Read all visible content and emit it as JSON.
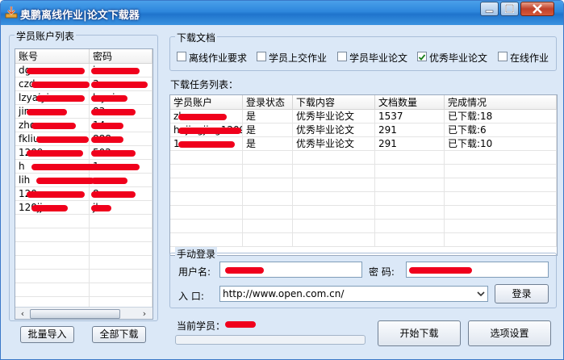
{
  "window": {
    "title": "奥鹏离线作业|论文下载器"
  },
  "accounts": {
    "group_title": "学员账户列表",
    "columns": [
      "账号",
      "密码"
    ],
    "rows": [
      {
        "account": "dg",
        "password": "ia..."
      },
      {
        "account": "czd",
        "password": "3"
      },
      {
        "account": "lzyaiyi",
        "password": "lzyai"
      },
      {
        "account": "jinsu",
        "password": "83"
      },
      {
        "account": "zhou",
        "password": "14"
      },
      {
        "account": "fkliu",
        "password": "888"
      },
      {
        "account": "1209",
        "password": "502"
      },
      {
        "account": "h",
        "password": "1..."
      },
      {
        "account": "lih",
        "password": "..."
      },
      {
        "account": "120",
        "password": "8"
      },
      {
        "account": "120jj",
        "password": "jh"
      }
    ],
    "scroll_left": "‹",
    "scroll_right": "›",
    "btn_import": "批量导入",
    "btn_download_all": "全部下载"
  },
  "download_docs": {
    "group_title": "下载文档",
    "options": [
      {
        "label": "离线作业要求",
        "checked": false
      },
      {
        "label": "学员上交作业",
        "checked": false
      },
      {
        "label": "学员毕业论文",
        "checked": false
      },
      {
        "label": "优秀毕业论文",
        "checked": true
      },
      {
        "label": "在线作业",
        "checked": false
      }
    ]
  },
  "tasks": {
    "title": "下载任务列表：",
    "columns": [
      "学员账户",
      "登录状态",
      "下载内容",
      "文档数量",
      "完成情况"
    ],
    "rows": [
      {
        "account": "zh",
        "status": "是",
        "content": "优秀毕业论文",
        "count": "1537",
        "progress": "已下载:18"
      },
      {
        "account": "hejingjing1209",
        "status": "是",
        "content": "优秀毕业论文",
        "count": "291",
        "progress": "已下载:6"
      },
      {
        "account": "1",
        "status": "是",
        "content": "优秀毕业论文",
        "count": "291",
        "progress": "已下载:10"
      }
    ]
  },
  "manual_login": {
    "group_title": "手动登录",
    "username_label": "用户名:",
    "username_value": "",
    "password_label": "密 码:",
    "password_value": "",
    "entry_label": "入 口:",
    "entry_value": "http://www.open.com.cn/",
    "login_button": "登录"
  },
  "footer": {
    "current_student_label": "当前学员：",
    "progress": 0,
    "btn_start": "开始下载",
    "btn_options": "选项设置"
  },
  "colors": {
    "redaction": "#f0001c",
    "title_bar": "#2d86dc"
  }
}
